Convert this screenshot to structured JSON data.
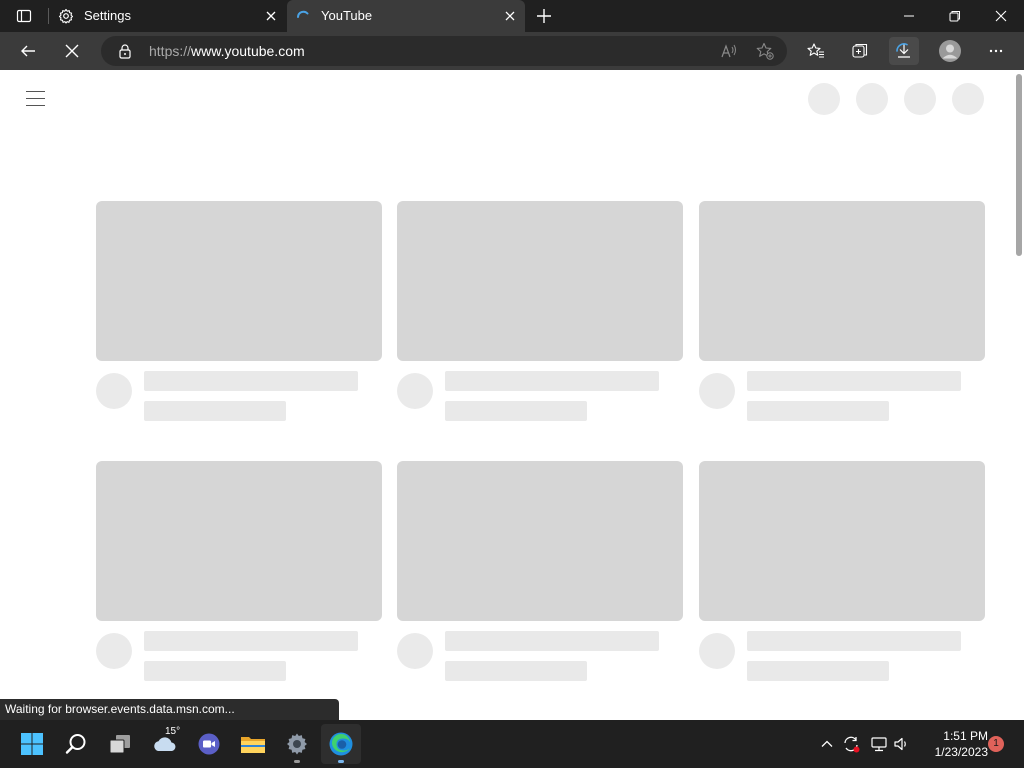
{
  "browser": {
    "tabs": [
      {
        "title": "Settings",
        "icon": "gear-icon",
        "active": false
      },
      {
        "title": "YouTube",
        "icon": "loading-spinner-icon",
        "active": true
      }
    ],
    "new_tab_icon": "plus-icon",
    "window_controls": [
      "minimize-icon",
      "restore-icon",
      "close-icon"
    ],
    "address_bar": {
      "scheme": "https://",
      "host_prefix": "www",
      "host_rest": ".youtube.com"
    },
    "toolbar_icons": [
      "back-arrow-icon",
      "stop-loading-icon",
      "read-aloud-icon",
      "add-favorite-icon",
      "favorites-icon",
      "collections-icon",
      "downloads-icon",
      "profile-icon",
      "more-icon"
    ],
    "status_text": "Waiting for browser.events.data.msn.com..."
  },
  "page": {
    "menu_icon": "hamburger-menu-icon",
    "header_placeholders": 4,
    "card_placeholders": 6
  },
  "taskbar": {
    "apps": [
      "windows-start-icon",
      "search-icon",
      "task-view-icon",
      "weather-icon",
      "teams-chat-icon",
      "file-explorer-icon",
      "settings-gear-icon",
      "edge-browser-icon"
    ],
    "weather_temp": "15°",
    "tray_icons": [
      "chevron-up-icon",
      "sync-icon",
      "network-icon",
      "volume-icon"
    ],
    "time": "1:51 PM",
    "date": "1/23/2023",
    "notification_count": "1"
  },
  "colors": {
    "tabstrip": "#202020",
    "toolbar": "#3b3b3b",
    "skeleton_thumb": "#d6d6d6",
    "skeleton_line": "#e9e9e9",
    "accent_blue": "#0078d4"
  }
}
